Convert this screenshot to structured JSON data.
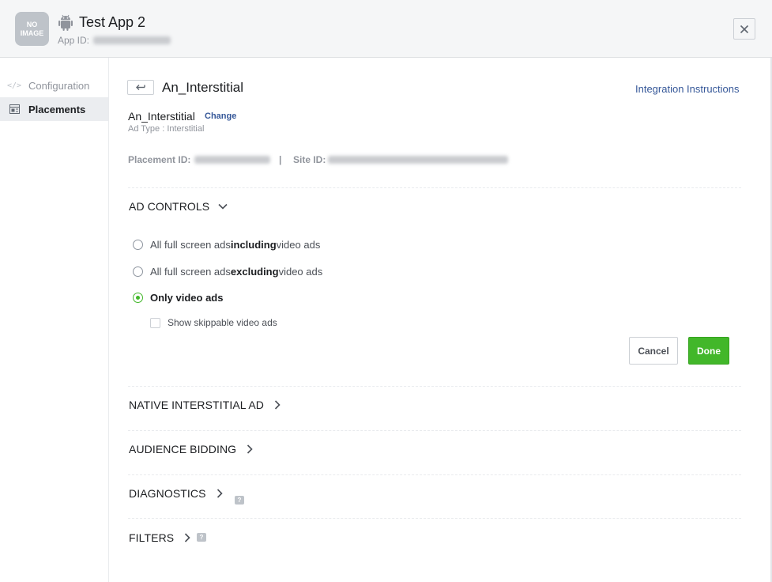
{
  "header": {
    "app_thumb_line1": "NO",
    "app_thumb_line2": "IMAGE",
    "app_title": "Test App 2",
    "app_id_label": "App ID:",
    "platform_icon": "android-icon",
    "close_icon": "close-icon"
  },
  "sidebar": {
    "items": [
      {
        "icon": "code-icon",
        "icon_glyph": "</>",
        "label": "Configuration"
      },
      {
        "icon": "placements-icon",
        "label": "Placements",
        "active": true
      }
    ]
  },
  "main": {
    "back_icon": "back-arrow-icon",
    "heading": "An_Interstitial",
    "integration_link": "Integration Instructions",
    "placement_name": "An_Interstitial",
    "change_link": "Change",
    "ad_type": "Ad Type : Interstitial",
    "placement_id_label": "Placement ID:",
    "separator": "|",
    "site_id_label": "Site ID:"
  },
  "ad_controls": {
    "title": "AD CONTROLS",
    "expanded": true,
    "options": [
      {
        "pre": "All full screen ads ",
        "bold": "including",
        "post": " video ads",
        "selected": false
      },
      {
        "pre": "All full screen ads ",
        "bold": "excluding",
        "post": " video ads",
        "selected": false
      },
      {
        "label": "Only video ads",
        "selected": true
      }
    ],
    "checkbox_label": "Show skippable video ads",
    "checkbox_checked": false,
    "cancel_label": "Cancel",
    "done_label": "Done"
  },
  "sections": [
    {
      "title": "NATIVE INTERSTITIAL AD"
    },
    {
      "title": "AUDIENCE BIDDING"
    },
    {
      "title": "DIAGNOSTICS"
    },
    {
      "title": "FILTERS"
    }
  ],
  "colors": {
    "accent_green": "#42b72a",
    "link_blue": "#365899",
    "header_bg": "#f5f6f7"
  }
}
